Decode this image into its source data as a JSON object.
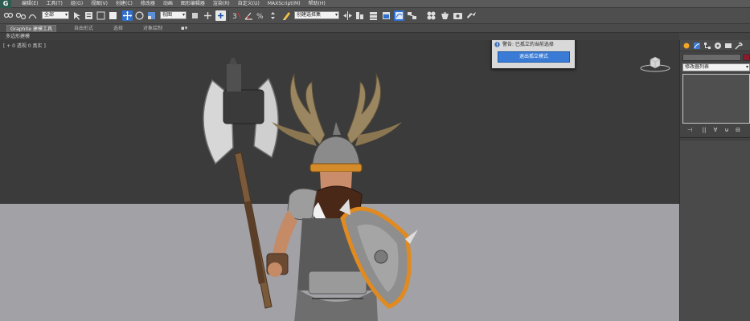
{
  "menu": {
    "logo": "G",
    "items": [
      "编辑(E)",
      "工具(T)",
      "组(G)",
      "视图(V)",
      "创建(C)",
      "修改器",
      "动画",
      "图形编辑器",
      "渲染(R)",
      "自定义(U)",
      "MAXScript(M)",
      "帮助(H)"
    ]
  },
  "toolbar": {
    "scope_select": "全部",
    "ref_coord_select": "视图",
    "selection_set_select": "创建选择集"
  },
  "ribbon": {
    "tabs": [
      "Graphite 建模工具",
      "自由形式",
      "选择",
      "对象绘制"
    ],
    "active_tab": "Graphite 建模工具",
    "sub_label": "多边形建模"
  },
  "viewport": {
    "label": "[ + 0 透视 0 真实 ]"
  },
  "command_panel": {
    "modifier_list": "修改器列表",
    "stack_tools": [
      "⊣",
      "||",
      "∀",
      "⊎",
      "⊟"
    ]
  },
  "popup": {
    "title": "警告: 已孤立的当前选择",
    "button": "退出孤立模式"
  },
  "colors": {
    "accent_blue": "#3a7bd5",
    "object_color": "#8a1a2c",
    "ground": "#a1a1a6",
    "background": "#3b3b3b"
  }
}
